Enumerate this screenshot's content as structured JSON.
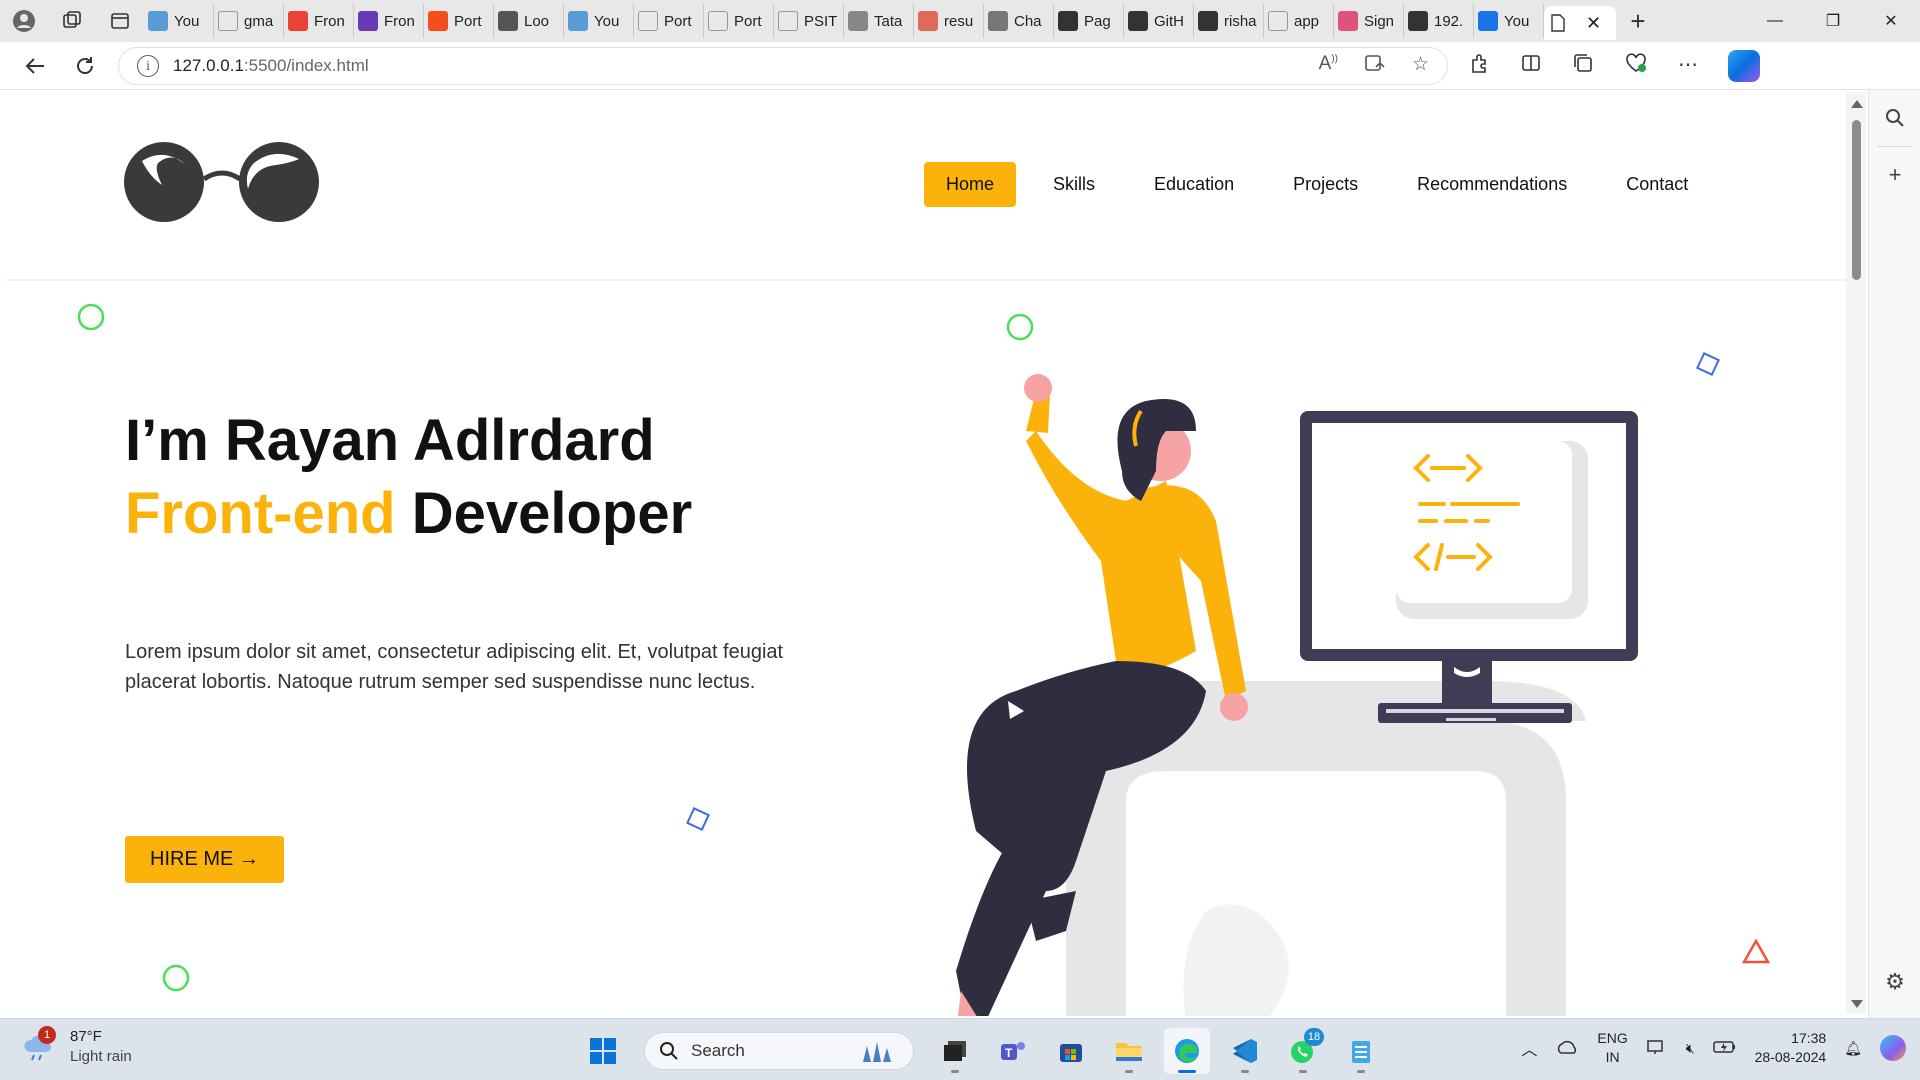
{
  "browser": {
    "tabs": [
      {
        "label": "You",
        "icon": "s-logo-icon",
        "color": "#5b9bd5"
      },
      {
        "label": "gma",
        "icon": "search-icon",
        "color": "#ffffff"
      },
      {
        "label": "Fron",
        "icon": "gmail-icon",
        "color": "#ea4335"
      },
      {
        "label": "Fron",
        "icon": "form-icon",
        "color": "#673ab7"
      },
      {
        "label": "Port",
        "icon": "figma-icon",
        "color": "#f24e1e"
      },
      {
        "label": "Loo",
        "icon": "s-logo-icon",
        "color": "#555555"
      },
      {
        "label": "You",
        "icon": "s-logo-icon",
        "color": "#5b9bd5"
      },
      {
        "label": "Port",
        "icon": "page-icon",
        "color": "#ffffff"
      },
      {
        "label": "Port",
        "icon": "page-icon",
        "color": "#ffffff"
      },
      {
        "label": "PSIT",
        "icon": "page-icon",
        "color": "#ffffff"
      },
      {
        "label": "Tata",
        "icon": "tata-icon",
        "color": "#888888"
      },
      {
        "label": "resu",
        "icon": "pdf-icon",
        "color": "#e06a5a"
      },
      {
        "label": "Cha",
        "icon": "chatgpt-icon",
        "color": "#777777"
      },
      {
        "label": "Pag",
        "icon": "github-icon",
        "color": "#333333"
      },
      {
        "label": "GitH",
        "icon": "github-icon",
        "color": "#333333"
      },
      {
        "label": "risha",
        "icon": "github-icon",
        "color": "#333333"
      },
      {
        "label": "app",
        "icon": "search-icon",
        "color": "#ffffff"
      },
      {
        "label": "Sign",
        "icon": "canva-icon",
        "color": "#e0527e"
      },
      {
        "label": "192.",
        "icon": "settings-page-icon",
        "color": "#333333"
      },
      {
        "label": "You",
        "icon": "s-logo-icon",
        "color": "#1a73e8"
      }
    ],
    "active_tab_icon": "page-icon",
    "address": {
      "host": "127.0.0.1",
      "path": ":5500/index.html"
    }
  },
  "site": {
    "nav": [
      "Home",
      "Skills",
      "Education",
      "Projects",
      "Recommendations",
      "Contact"
    ],
    "active_nav": "Home",
    "hero": {
      "line1": "I’m Rayan Adlrdard",
      "accent": "Front-end",
      "line2_rest": " Developer",
      "description": "Lorem ipsum dolor sit amet, consectetur adipiscing elit. Et, volutpat feugiat placerat lobortis. Natoque rutrum semper sed suspendisse nunc lectus.",
      "cta": "HIRE ME →"
    },
    "colors": {
      "accent": "#fbb30c",
      "dark": "#3f3d56",
      "shape_green": "#4ade5a",
      "shape_blue": "#3b6fe0",
      "shape_red": "#f0533a"
    }
  },
  "taskbar": {
    "weather": {
      "temp": "87°F",
      "condition": "Light rain",
      "badge": "1"
    },
    "search_placeholder": "Search",
    "whatsapp_badge": "18",
    "lang": {
      "line1": "ENG",
      "line2": "IN"
    },
    "clock": {
      "time": "17:38",
      "date": "28-08-2024"
    }
  }
}
